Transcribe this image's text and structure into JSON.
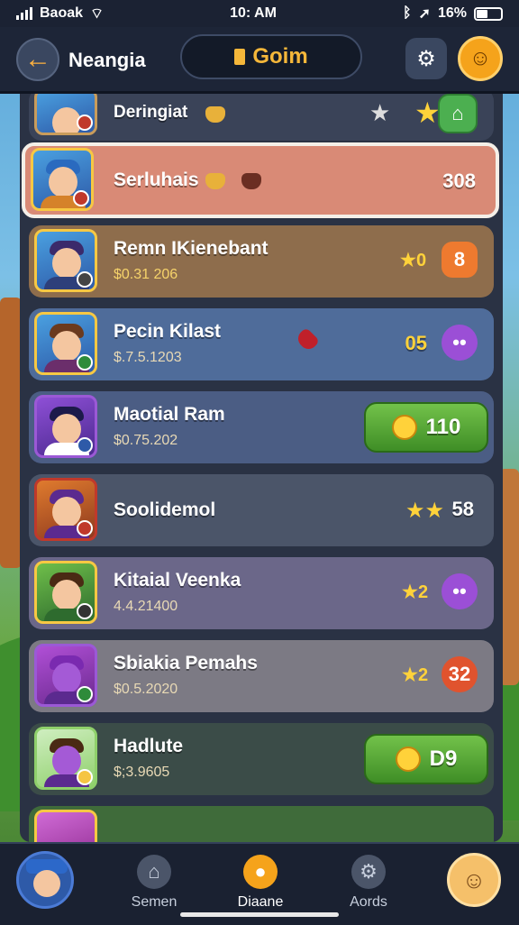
{
  "status_bar": {
    "carrier": "Baoak",
    "time": "10: AM",
    "battery": "16%"
  },
  "header": {
    "back_icon": "back-arrow-icon",
    "title": "Neangia",
    "game_label": "Goim",
    "settings_icon": "settings-icon",
    "profile_icon": "profile-icon"
  },
  "rows": [
    {
      "name": "Deringiat",
      "score_text": "",
      "bg": "#3a4358"
    },
    {
      "name": "Serluhais",
      "score_text": "308",
      "bg": "#d98a76"
    },
    {
      "name": "Remn IKienebant",
      "sub": "$0.31 206",
      "score_text": "8",
      "stars_text": "0",
      "bg": "#8e6d4c"
    },
    {
      "name": "Pecin Kilast",
      "sub": "$.7.5.1203",
      "score_text": "05",
      "bg": "#4f6c9a"
    },
    {
      "name": "Maotial Ram",
      "sub": "$0.75.202",
      "score_text": "110",
      "bg": "#4b5d84"
    },
    {
      "name": "Soolidemol",
      "score_text": "58",
      "bg": "#4b5569"
    },
    {
      "name": "Kitaial Veenka",
      "sub": "4.4.21400",
      "score_text": "2",
      "bg": "#6b6789"
    },
    {
      "name": "Sbiakia Pemahs",
      "sub": "$0.5.2020",
      "score_text": "32",
      "stars_text": "2",
      "bg": "#7c7a84"
    },
    {
      "name": "Hadlute",
      "sub": "$;3.9605",
      "score_text": "D9",
      "bg": "#3b4c48"
    }
  ],
  "bottom_nav": {
    "items": [
      {
        "label": "Semen"
      },
      {
        "label": "Diaane"
      },
      {
        "label": "Aords"
      }
    ]
  }
}
